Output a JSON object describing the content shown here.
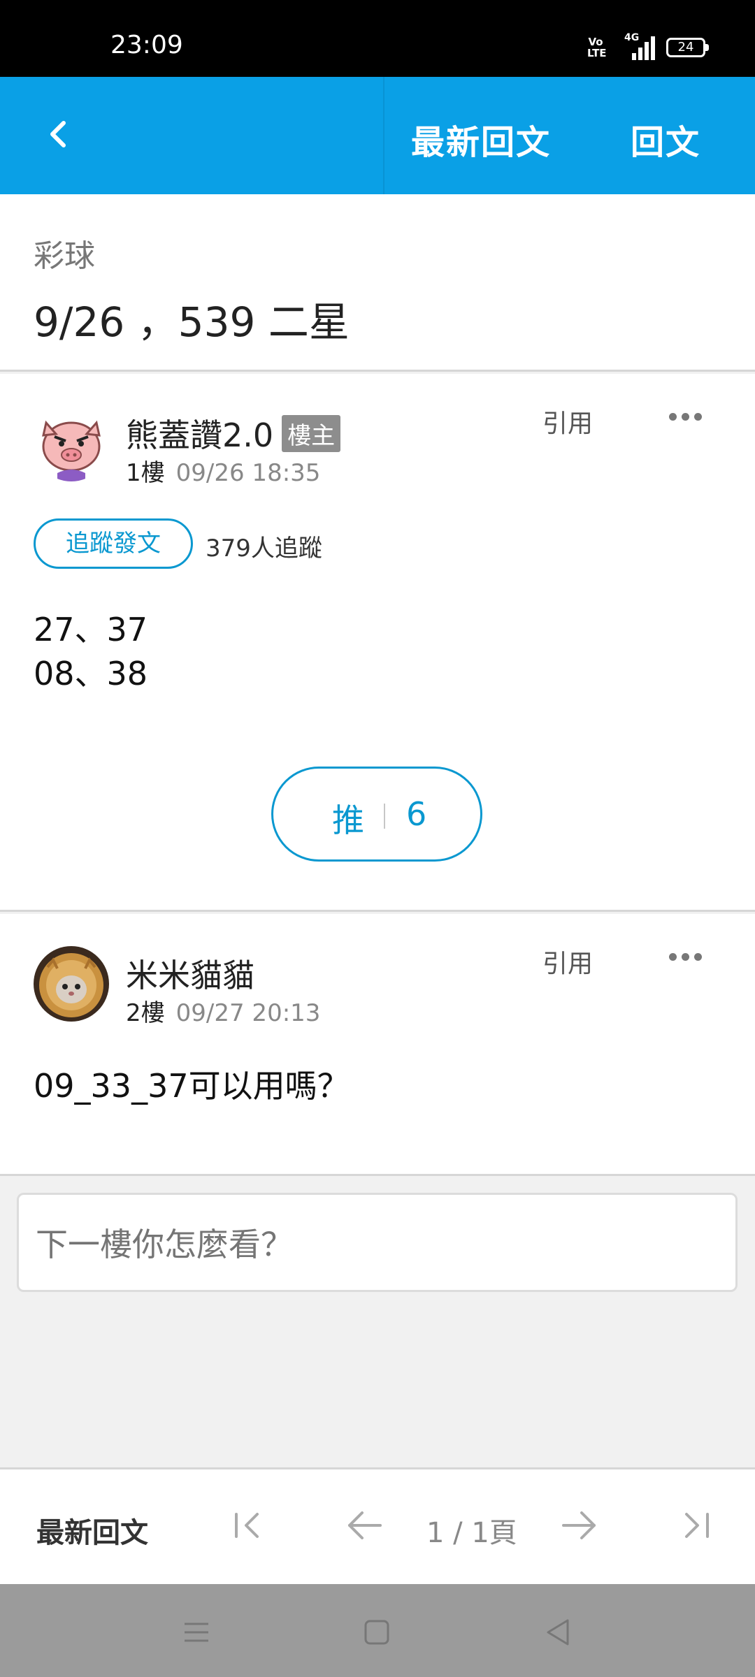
{
  "status_bar": {
    "time": "23:09",
    "volte": "Vo LTE",
    "network": "4G",
    "battery": "24"
  },
  "app_bar": {
    "back_icon": "chevron-left-icon",
    "latest_replies": "最新回文",
    "reply": "回文",
    "color": "#0aa0e6"
  },
  "board": {
    "category": "彩球",
    "title": "9/26 ，539 二星"
  },
  "posts": [
    {
      "username": "熊蓋讚2.0",
      "badge": "樓主",
      "floor": "1樓",
      "datetime": "09/26 18:35",
      "quote_label": "引用",
      "follow_label": "追蹤發文",
      "followers": "379人追蹤",
      "body": [
        "27、37",
        "08、38"
      ],
      "push_label": "推",
      "push_count": "6"
    },
    {
      "username": "米米貓貓",
      "floor": "2樓",
      "datetime": "09/27 20:13",
      "quote_label": "引用",
      "body": [
        "09_33_37可以用嗎？"
      ]
    }
  ],
  "reply_input": {
    "placeholder": "下一樓你怎麼看？"
  },
  "pager": {
    "latest_label": "最新回文",
    "page_text": "1 / 1頁"
  }
}
